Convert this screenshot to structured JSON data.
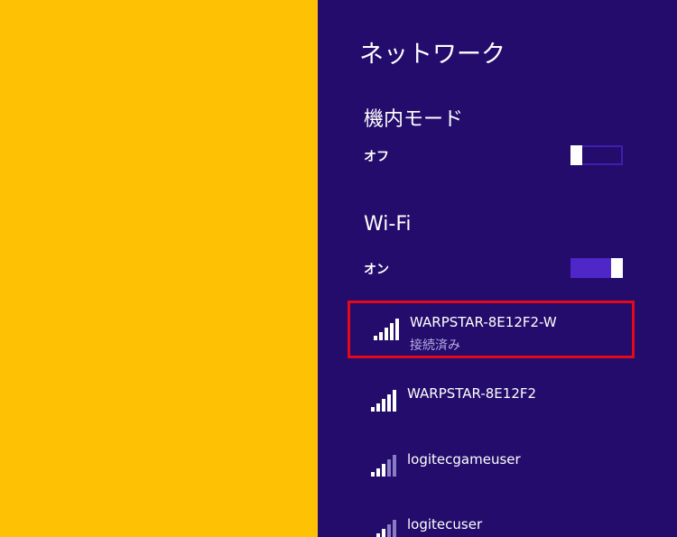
{
  "panel": {
    "title": "ネットワーク"
  },
  "airplane_mode": {
    "title": "機内モード",
    "state_label": "オフ",
    "on": false
  },
  "wifi": {
    "title": "Wi-Fi",
    "state_label": "オン",
    "on": true
  },
  "networks": [
    {
      "name": "WARPSTAR-8E12F2-W",
      "status": "接続済み",
      "selected": true,
      "signal": "full"
    },
    {
      "name": "WARPSTAR-8E12F2",
      "status": "",
      "selected": false,
      "signal": "full"
    },
    {
      "name": "logitecgameuser",
      "status": "",
      "selected": false,
      "signal": "partial"
    },
    {
      "name": "logitecuser",
      "status": "",
      "selected": false,
      "signal": "partial"
    }
  ],
  "colors": {
    "desktop_background": "#fec104",
    "charm_background": "#230c6b",
    "toggle_on": "#4f27c8",
    "highlight_border": "#e3091b"
  },
  "icons": {
    "signal": "wifi-signal-icon"
  }
}
